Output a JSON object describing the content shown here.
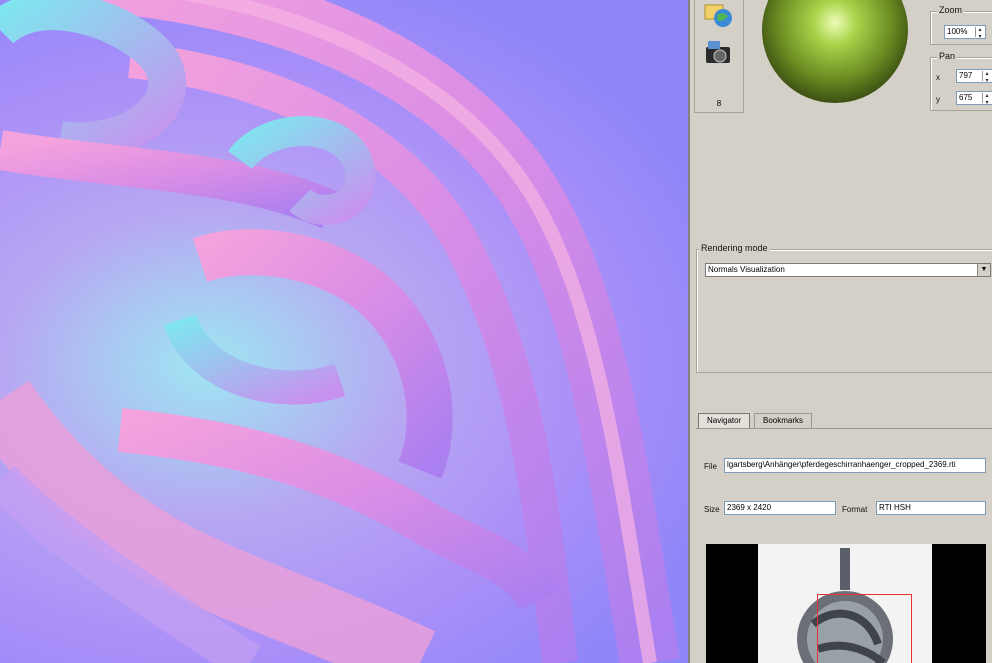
{
  "panel": {
    "toolbar": {
      "counter": "8"
    },
    "zoom": {
      "label": "Zoom",
      "value": "100%"
    },
    "pan": {
      "label": "Pan",
      "x_label": "x",
      "x_value": "797",
      "y_label": "y",
      "y_value": "675"
    },
    "rendering": {
      "label": "Rendering mode",
      "selected": "Normals Visualization"
    },
    "tabs": [
      {
        "label": "Navigator"
      },
      {
        "label": "Bookmarks"
      }
    ],
    "file": {
      "label": "File",
      "value": "lgartsberg\\Anhänger\\pferdegeschirranhaenger_cropped_2369.rti"
    },
    "size": {
      "label": "Size",
      "value": "2369 x 2420"
    },
    "format": {
      "label": "Format",
      "value": "RTI HSH"
    }
  },
  "colors": {
    "panel_bg": "#d4d0c8",
    "normal_map_purple": "#9b8af9",
    "normal_map_cyan": "#9ee6f2",
    "normal_map_pink": "#e98fd9",
    "light_sphere": "#c8f07a",
    "nav_frame": "#e63232"
  },
  "icons": [
    "open-web-icon",
    "snapshot-camera-icon",
    "light-direction-sphere"
  ]
}
